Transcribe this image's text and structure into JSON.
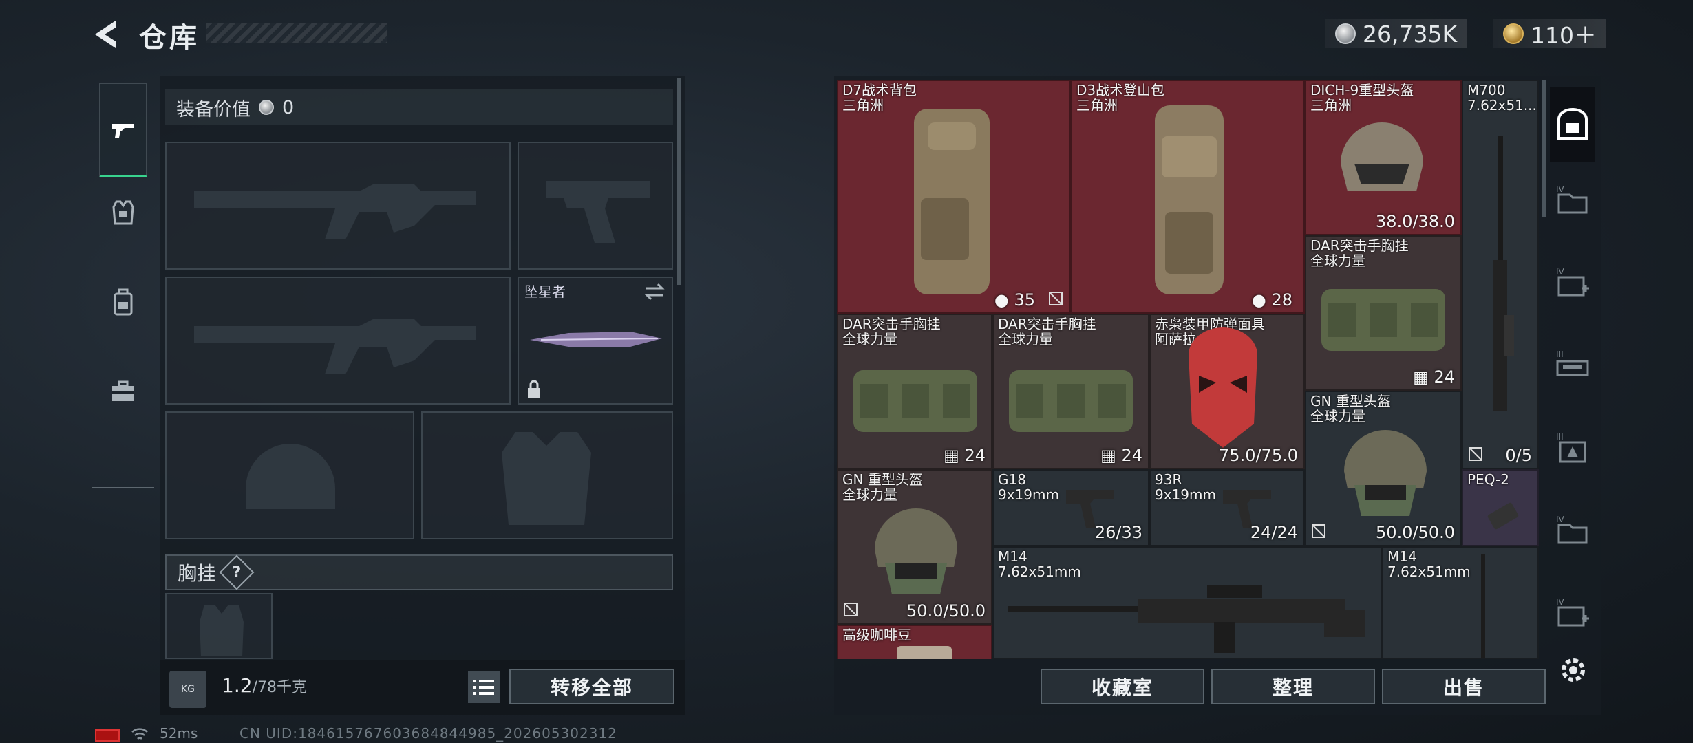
{
  "header": {
    "title": "仓库",
    "currency_main": "26,735K",
    "currency_premium": "110＋"
  },
  "left_tabs": [
    {
      "name": "weapons",
      "icon": "pistol-icon",
      "active": true
    },
    {
      "name": "armor",
      "icon": "armor-vest-icon",
      "active": false
    },
    {
      "name": "backpack",
      "icon": "backpack-icon",
      "active": false
    },
    {
      "name": "toolbox",
      "icon": "toolbox-icon",
      "active": false
    }
  ],
  "loadout": {
    "equip_value_label": "装备价值",
    "equip_value": "0",
    "melee_name": "坠星者",
    "chest_label": "胸挂",
    "help": "?"
  },
  "weight": {
    "icon_text": "KG",
    "current": "1.2",
    "max": "/78千克"
  },
  "buttons": {
    "transfer_all": "转移全部",
    "collection": "收藏室",
    "sort": "整理",
    "sell": "出售"
  },
  "items": [
    {
      "name": "D7战术背包",
      "sub": "三角洲",
      "value": "35"
    },
    {
      "name": "D3战术登山包",
      "sub": "三角洲",
      "value": "28"
    },
    {
      "name": "DICH-9重型头盔",
      "sub": "三角洲",
      "value": "38.0/38.0"
    },
    {
      "name": "M700",
      "sub": "7.62x51...",
      "value": "0/5"
    },
    {
      "name": "DAR突击手胸挂",
      "sub": "全球力量",
      "value": "24"
    },
    {
      "name": "DAR突击手胸挂",
      "sub": "全球力量",
      "value": "24"
    },
    {
      "name": "DAR突击手胸挂",
      "sub": "全球力量",
      "value": "24"
    },
    {
      "name": "赤枭装甲防弹面具",
      "sub": "阿萨拉",
      "value": "75.0/75.0"
    },
    {
      "name": "GN 重型头盔",
      "sub": "全球力量",
      "value": "50.0/50.0"
    },
    {
      "name": "GN 重型头盔",
      "sub": "全球力量",
      "value": "50.0/50.0"
    },
    {
      "name": "G18",
      "sub": "9x19mm",
      "value": "26/33"
    },
    {
      "name": "93R",
      "sub": "9x19mm",
      "value": "24/24"
    },
    {
      "name": "PEQ-2",
      "sub": "",
      "value": ""
    },
    {
      "name": "M14",
      "sub": "7.62x51mm",
      "value": ""
    },
    {
      "name": "M14",
      "sub": "7.62x51mm",
      "value": ""
    },
    {
      "name": "高级咖啡豆",
      "sub": "",
      "value": ""
    }
  ],
  "right_tabs": [
    {
      "label": "",
      "icon": "safe-box-icon",
      "active": true
    },
    {
      "label": "IV",
      "icon": "stash-folder-icon"
    },
    {
      "label": "IV",
      "icon": "medical-case-icon"
    },
    {
      "label": "III",
      "icon": "weapon-case-icon"
    },
    {
      "label": "III",
      "icon": "ammo-case-icon"
    },
    {
      "label": "IV",
      "icon": "stash-folder-icon"
    },
    {
      "label": "IV",
      "icon": "medical-case-icon"
    }
  ],
  "status": {
    "ping": "52ms",
    "uid": "CN UID:184615767603684844985_202605302312"
  },
  "colors": {
    "accent_green": "#38d38e",
    "rarity_red": "#6b2730",
    "rarity_purple": "#3a3448"
  }
}
